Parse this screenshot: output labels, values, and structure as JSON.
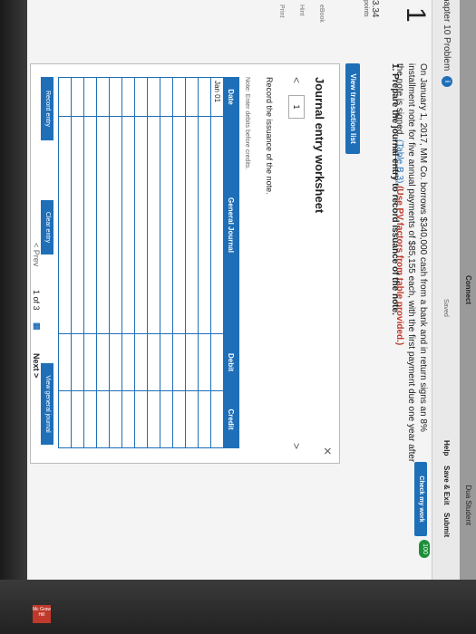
{
  "app": {
    "title": "Connect",
    "user": "Dua Student"
  },
  "header": {
    "problem_title": "hapter 10 Problem",
    "info_glyph": "i",
    "saved": "Saved",
    "help": "Help",
    "save_exit": "Save & Exit",
    "submit": "Submit",
    "check_work": "Check my work",
    "score": "100"
  },
  "problem": {
    "number": "1",
    "points_value": "3.34",
    "points_label": "points",
    "side_links": [
      "eBook",
      "Hint",
      "Print"
    ],
    "text_main": "On January 1, 2017, MM Co. borrows $340,000 cash from a bank and in return signs an 8% installment note for five annual payments of $85,155 each, with the first payment due one year after the note is signed.",
    "table_link": "(Table B.3)",
    "red_text": "(Use PV factors from table provided.)",
    "part": "1. Prepare the journal entry to record issuance of the note."
  },
  "worksheet": {
    "view_list": "View transaction list",
    "title": "Journal entry worksheet",
    "tab": "1",
    "instruction": "Record the issuance of the note.",
    "note": "Note: Enter debits before credits.",
    "columns": [
      "Date",
      "General Journal",
      "Debit",
      "Credit"
    ],
    "rows": [
      [
        "Jan 01",
        "",
        "",
        ""
      ],
      [
        "",
        "",
        "",
        ""
      ],
      [
        "",
        "",
        "",
        ""
      ],
      [
        "",
        "",
        "",
        ""
      ],
      [
        "",
        "",
        "",
        ""
      ],
      [
        "",
        "",
        "",
        ""
      ],
      [
        "",
        "",
        "",
        ""
      ],
      [
        "",
        "",
        "",
        ""
      ],
      [
        "",
        "",
        "",
        ""
      ],
      [
        "",
        "",
        "",
        ""
      ],
      [
        "",
        "",
        "",
        ""
      ],
      [
        "",
        "",
        "",
        ""
      ],
      [
        "",
        "",
        "",
        ""
      ]
    ],
    "record_entry": "Record entry",
    "clear_entry": "Clear entry",
    "view_general": "View general journal"
  },
  "pager": {
    "prev": "Prev",
    "count": "1 of 3",
    "next": "Next"
  },
  "logo": {
    "text": "Mc Graw Hill"
  },
  "colors": {
    "accent": "#1f6fb8",
    "success": "#1d8f3a",
    "warning": "#c0392b"
  }
}
